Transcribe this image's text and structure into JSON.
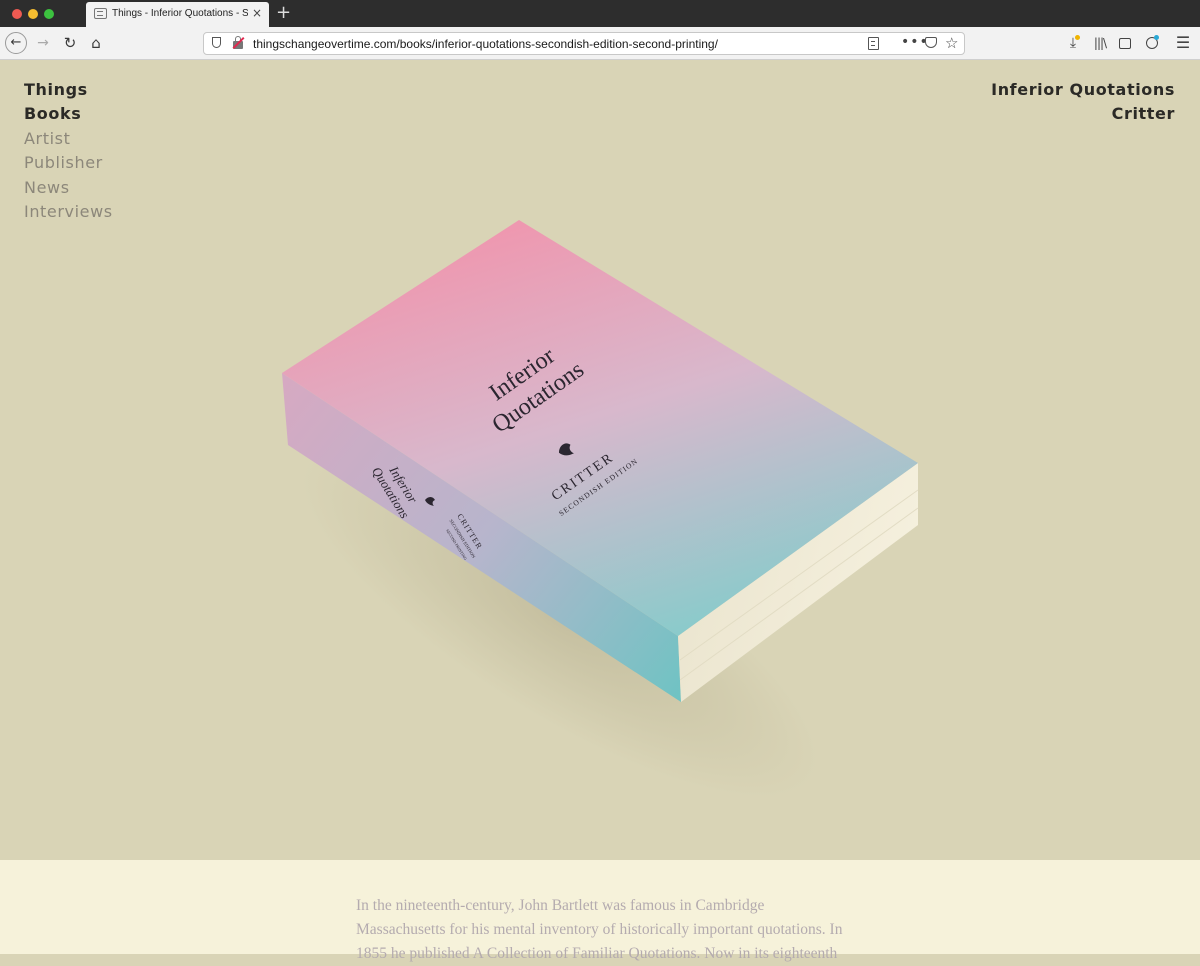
{
  "browser": {
    "tab_title": "Things - Inferior Quotations - S",
    "tab_close": "×",
    "new_tab": "+",
    "url": "thingschangeovertime.com/books/inferior-quotations-secondish-edition-second-printing/",
    "icons": [
      "back-icon",
      "forward-icon",
      "reload-icon",
      "home-icon",
      "shield-icon",
      "insecure-lock-icon",
      "reader-view-icon",
      "more-icon",
      "pocket-icon",
      "bookmark-star-icon",
      "downloads-icon",
      "library-icon",
      "sidebar-icon",
      "account-icon",
      "menu-icon"
    ]
  },
  "nav_left": {
    "items": [
      {
        "label": "Things"
      },
      {
        "label": "Books"
      },
      {
        "label": "Artist"
      },
      {
        "label": "Publisher"
      },
      {
        "label": "News"
      },
      {
        "label": "Interviews"
      }
    ]
  },
  "nav_right": {
    "title": "Inferior Quotations",
    "subtitle": "Critter"
  },
  "book_cover": {
    "title_line1": "Inferior",
    "title_line2": "Quotations",
    "publisher": "CRITTER",
    "edition": "SECONDISH EDITION",
    "spine_title_line1": "Inferior",
    "spine_title_line2": "Quotations",
    "spine_publisher": "CRITTER",
    "spine_edition": "SECONDISH EDITION",
    "spine_extra": "SECOND PRINTING"
  },
  "colors": {
    "background": "#d9d4b6",
    "text_section_bg": "#f6f2da",
    "cover_pink": "#ee98b0",
    "cover_teal": "#7ec9c9",
    "pages": "#f3eedc"
  },
  "body": {
    "paragraph": "In the nineteenth-century, John Bartlett was famous in Cambridge Massachusetts for his mental inventory of historically important quotations. In 1855 he published A Collection of Familiar Quotations. Now in its eighteenth"
  }
}
